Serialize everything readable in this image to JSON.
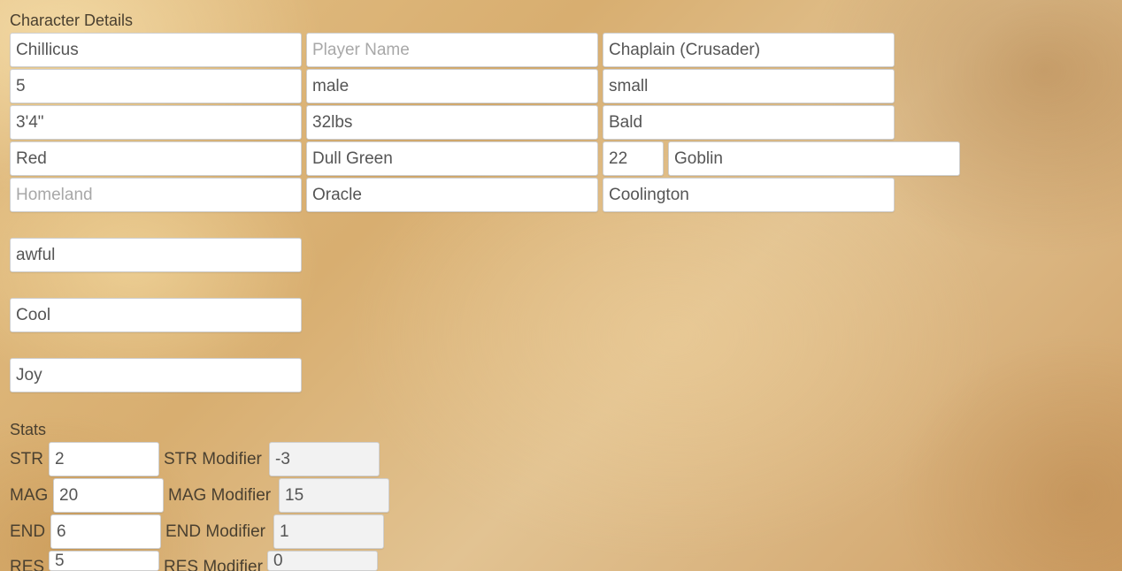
{
  "character_details": {
    "title": "Character Details",
    "name": "Chillicus",
    "player_name": {
      "value": "",
      "placeholder": "Player Name"
    },
    "class": "Chaplain (Crusader)",
    "level": "5",
    "gender": "male",
    "size": "small",
    "height": "3'4\"",
    "weight": "32lbs",
    "hair": "Bald",
    "eyes": "Red",
    "skin": "Dull Green",
    "age": "22",
    "race": "Goblin",
    "homeland": {
      "value": "",
      "placeholder": "Homeland"
    },
    "deity": "Oracle",
    "hometown": "Coolington",
    "trait_1": "awful",
    "trait_2": "Cool",
    "trait_3": "Joy"
  },
  "stats": {
    "title": "Stats",
    "rows": [
      {
        "label": "STR",
        "value": "2",
        "modifier_label": "STR Modifier",
        "modifier": "-3"
      },
      {
        "label": "MAG",
        "value": "20",
        "modifier_label": "MAG Modifier",
        "modifier": "15"
      },
      {
        "label": "END",
        "value": "6",
        "modifier_label": "END Modifier",
        "modifier": "1"
      },
      {
        "label": "RES",
        "value": "5",
        "modifier_label": "RES Modifier",
        "modifier": "0"
      }
    ]
  }
}
